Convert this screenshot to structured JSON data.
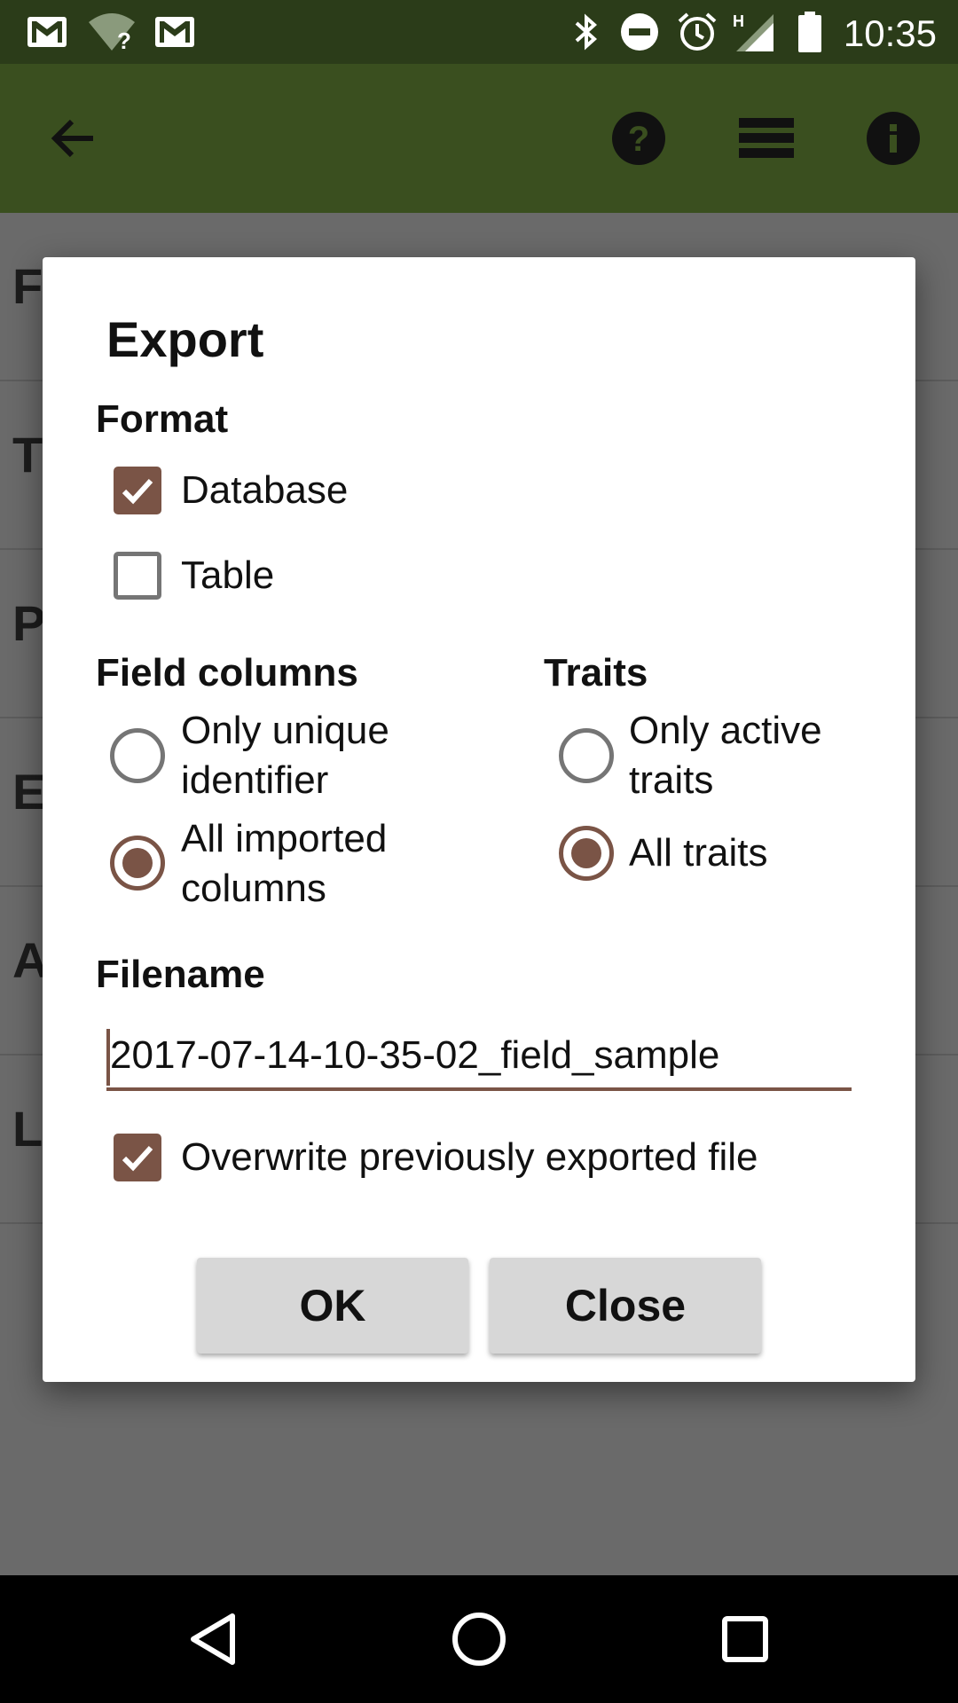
{
  "status_bar": {
    "time": "10:35",
    "left_icons": [
      "gmail-icon",
      "wifi-unknown-icon",
      "gmail-icon"
    ],
    "right_icons": [
      "bluetooth-icon",
      "do-not-disturb-icon",
      "alarm-icon",
      "signal-h-icon",
      "battery-icon"
    ],
    "network_type": "H",
    "wifi_unknown_mark": "?"
  },
  "app_bar": {
    "back_icon": "arrow-back-icon",
    "actions": [
      "help-icon",
      "list-icon",
      "info-icon"
    ]
  },
  "background_list": {
    "row_initials": [
      "F",
      "T",
      "P",
      "E",
      "A",
      "L"
    ]
  },
  "dialog": {
    "title": "Export",
    "format": {
      "heading": "Format",
      "options": [
        {
          "label": "Database",
          "checked": true
        },
        {
          "label": "Table",
          "checked": false
        }
      ]
    },
    "field_columns": {
      "heading": "Field columns",
      "options": [
        {
          "label_line1": "Only unique",
          "label_line2": "identifier",
          "selected": false
        },
        {
          "label_line1": "All imported",
          "label_line2": "columns",
          "selected": true
        }
      ]
    },
    "traits": {
      "heading": "Traits",
      "options": [
        {
          "label_line1": "Only active",
          "label_line2": "traits",
          "selected": false
        },
        {
          "label_line1": "All traits",
          "label_line2": "",
          "selected": true
        }
      ]
    },
    "filename": {
      "heading": "Filename",
      "value": "2017-07-14-10-35-02_field_sample"
    },
    "overwrite": {
      "label": "Overwrite previously exported file",
      "checked": true
    },
    "buttons": {
      "ok": "OK",
      "close": "Close"
    }
  },
  "nav_bar": {
    "buttons": [
      "back-triangle-icon",
      "home-circle-icon",
      "recents-square-icon"
    ]
  },
  "colors": {
    "status_bar": "#2b3c19",
    "app_bar": "#3a4f1f",
    "accent": "#7a5446",
    "scrim": "#6a6a6a"
  }
}
